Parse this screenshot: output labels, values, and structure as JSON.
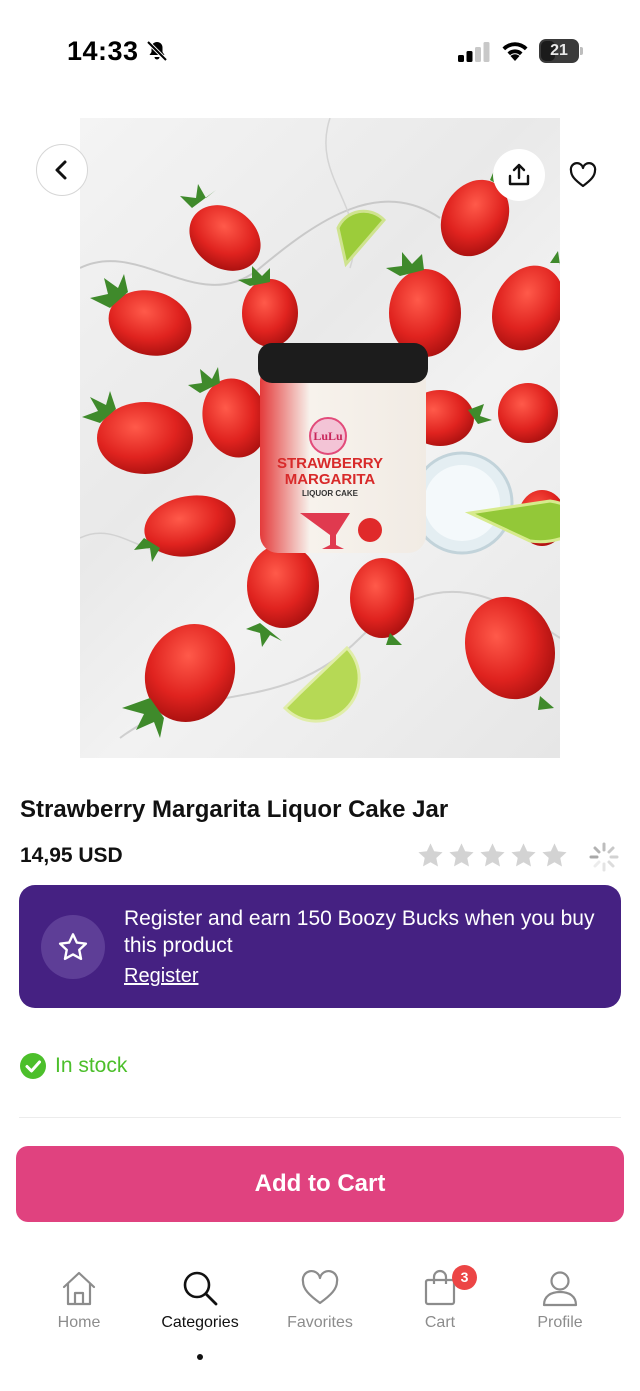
{
  "status_bar": {
    "time": "14:33",
    "battery": "21"
  },
  "product": {
    "title": "Strawberry Margarita Liquor Cake Jar",
    "price": "14,95 USD",
    "rating_stars": 0,
    "rating_max": 5,
    "image": {
      "jar_brand": "LuLu",
      "jar_line1": "STRAWBERRY",
      "jar_line2": "MARGARITA",
      "jar_line3": "LIQUOR CAKE"
    }
  },
  "promo": {
    "text": "Register and earn 150 Boozy Bucks when you buy this product",
    "link_label": "Register"
  },
  "stock": {
    "label": "In stock"
  },
  "cart_button": {
    "label": "Add to Cart"
  },
  "tabs": [
    {
      "label": "Home",
      "icon": "home-icon",
      "active": false
    },
    {
      "label": "Categories",
      "icon": "search-icon",
      "active": true
    },
    {
      "label": "Favorites",
      "icon": "heart-icon",
      "active": false
    },
    {
      "label": "Cart",
      "icon": "bag-icon",
      "active": false,
      "badge": "3"
    },
    {
      "label": "Profile",
      "icon": "user-icon",
      "active": false
    }
  ],
  "colors": {
    "accent_pink": "#e0427f",
    "promo_purple": "#452182",
    "stock_green": "#4cbf2b",
    "badge_red": "#ec4545"
  }
}
